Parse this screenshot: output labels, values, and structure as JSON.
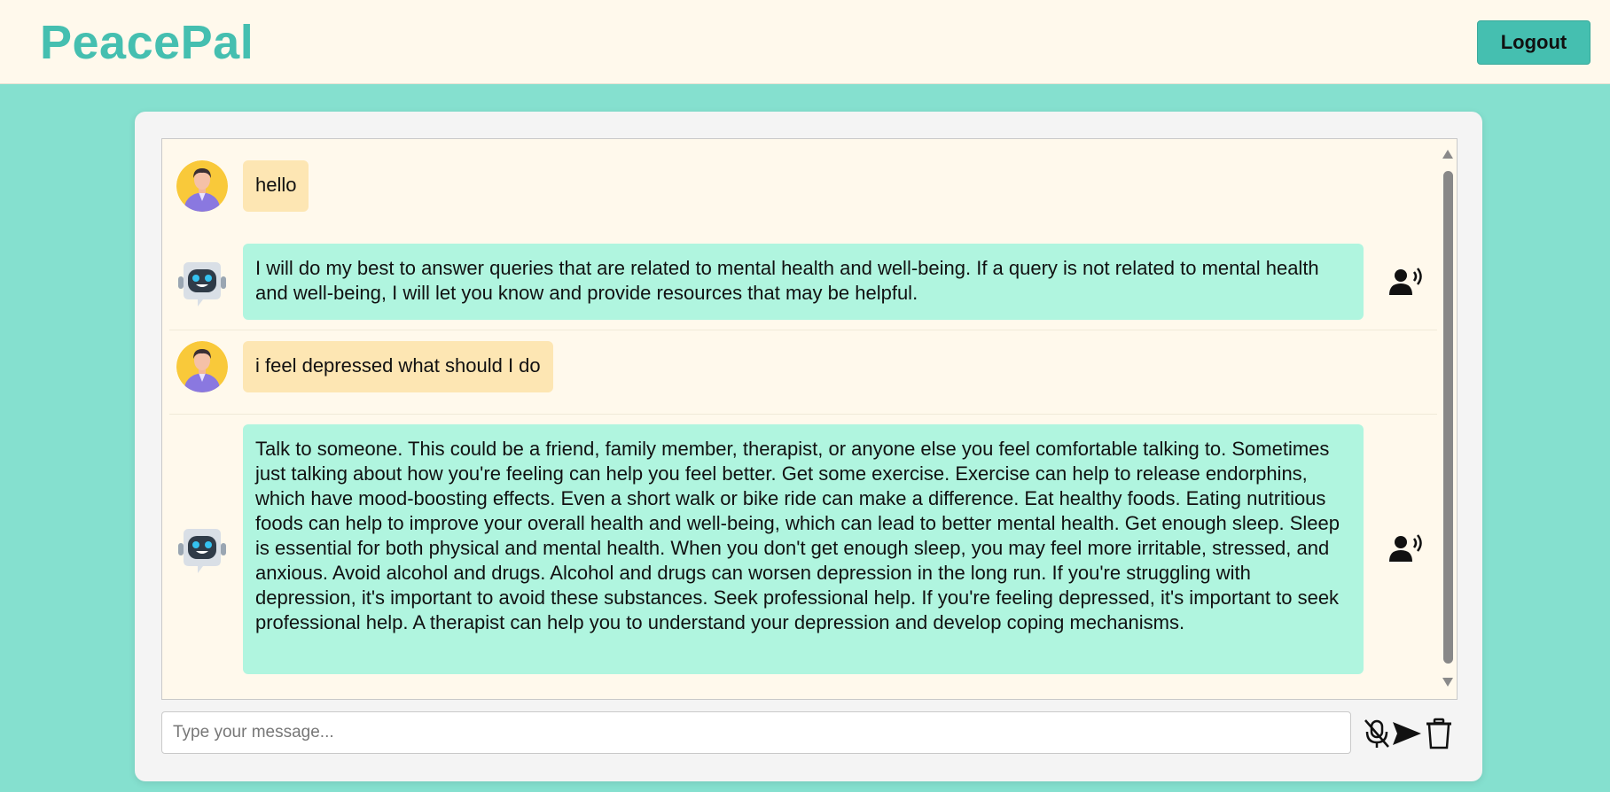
{
  "header": {
    "brand": "PeacePal",
    "logout_label": "Logout"
  },
  "chat": {
    "messages": [
      {
        "role": "user",
        "text": "hello"
      },
      {
        "role": "bot",
        "text": "I will do my best to answer queries that are related to mental health and well-being. If a query is not related to mental health and well-being, I will let you know and provide resources that may be helpful."
      },
      {
        "role": "user",
        "text": "i feel depressed what should I do"
      },
      {
        "role": "bot",
        "text": "Talk to someone. This could be a friend, family member, therapist, or anyone else you feel comfortable talking to. Sometimes just talking about how you're feeling can help you feel better. Get some exercise. Exercise can help to release endorphins, which have mood-boosting effects. Even a short walk or bike ride can make a difference. Eat healthy foods. Eating nutritious foods can help to improve your overall health and well-being, which can lead to better mental health. Get enough sleep. Sleep is essential for both physical and mental health. When you don't get enough sleep, you may feel more irritable, stressed, and anxious. Avoid alcohol and drugs. Alcohol and drugs can worsen depression in the long run. If you're struggling with depression, it's important to avoid these substances. Seek professional help. If you're feeling depressed, it's important to seek professional help. A therapist can help you to understand your depression and develop coping mechanisms."
      }
    ]
  },
  "composer": {
    "placeholder": "Type your message...",
    "value": ""
  },
  "icons": {
    "user_avatar": "user-avatar-icon",
    "bot_avatar": "robot-avatar-icon",
    "speak": "speaker-voice-icon",
    "mic": "microphone-off-icon",
    "send": "send-icon",
    "clear": "trash-icon"
  },
  "colors": {
    "brand": "#45bfb0",
    "page_background": "#85e0cf",
    "user_bubble": "#fde6b3",
    "bot_bubble": "#b0f5df",
    "chat_background": "#fff9ec"
  }
}
